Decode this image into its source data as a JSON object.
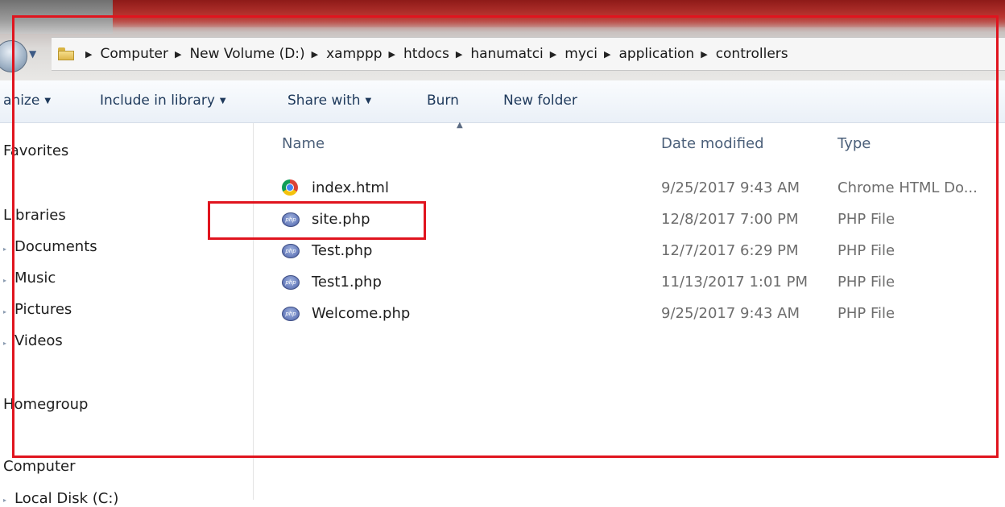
{
  "address": {
    "crumbs": [
      "Computer",
      "New Volume (D:)",
      "xamppp",
      "htdocs",
      "hanumatci",
      "myci",
      "application",
      "controllers"
    ]
  },
  "toolbar": {
    "organize": "anize",
    "include_in_library": "Include in library",
    "share_with": "Share with",
    "burn": "Burn",
    "new_folder": "New folder"
  },
  "nav": {
    "favorites": "Favorites",
    "libraries": "Libraries",
    "documents": "Documents",
    "music": "Music",
    "pictures": "Pictures",
    "videos": "Videos",
    "homegroup": "Homegroup",
    "computer": "Computer",
    "local_disk": "Local Disk (C:)"
  },
  "columns": {
    "name": "Name",
    "date_modified": "Date modified",
    "type": "Type"
  },
  "files": [
    {
      "name": "index.html",
      "date": "9/25/2017 9:43 AM",
      "type": "Chrome HTML Do...",
      "icon": "chrome-icon"
    },
    {
      "name": "site.php",
      "date": "12/8/2017 7:00 PM",
      "type": "PHP File",
      "icon": "php-icon"
    },
    {
      "name": "Test.php",
      "date": "12/7/2017 6:29 PM",
      "type": "PHP File",
      "icon": "php-icon"
    },
    {
      "name": "Test1.php",
      "date": "11/13/2017 1:01 PM",
      "type": "PHP File",
      "icon": "php-icon"
    },
    {
      "name": "Welcome.php",
      "date": "9/25/2017 9:43 AM",
      "type": "PHP File",
      "icon": "php-icon"
    }
  ],
  "colors": {
    "annotation_red": "#e0141e",
    "toolbar_text": "#1e395b",
    "header_text": "#4c607a"
  }
}
